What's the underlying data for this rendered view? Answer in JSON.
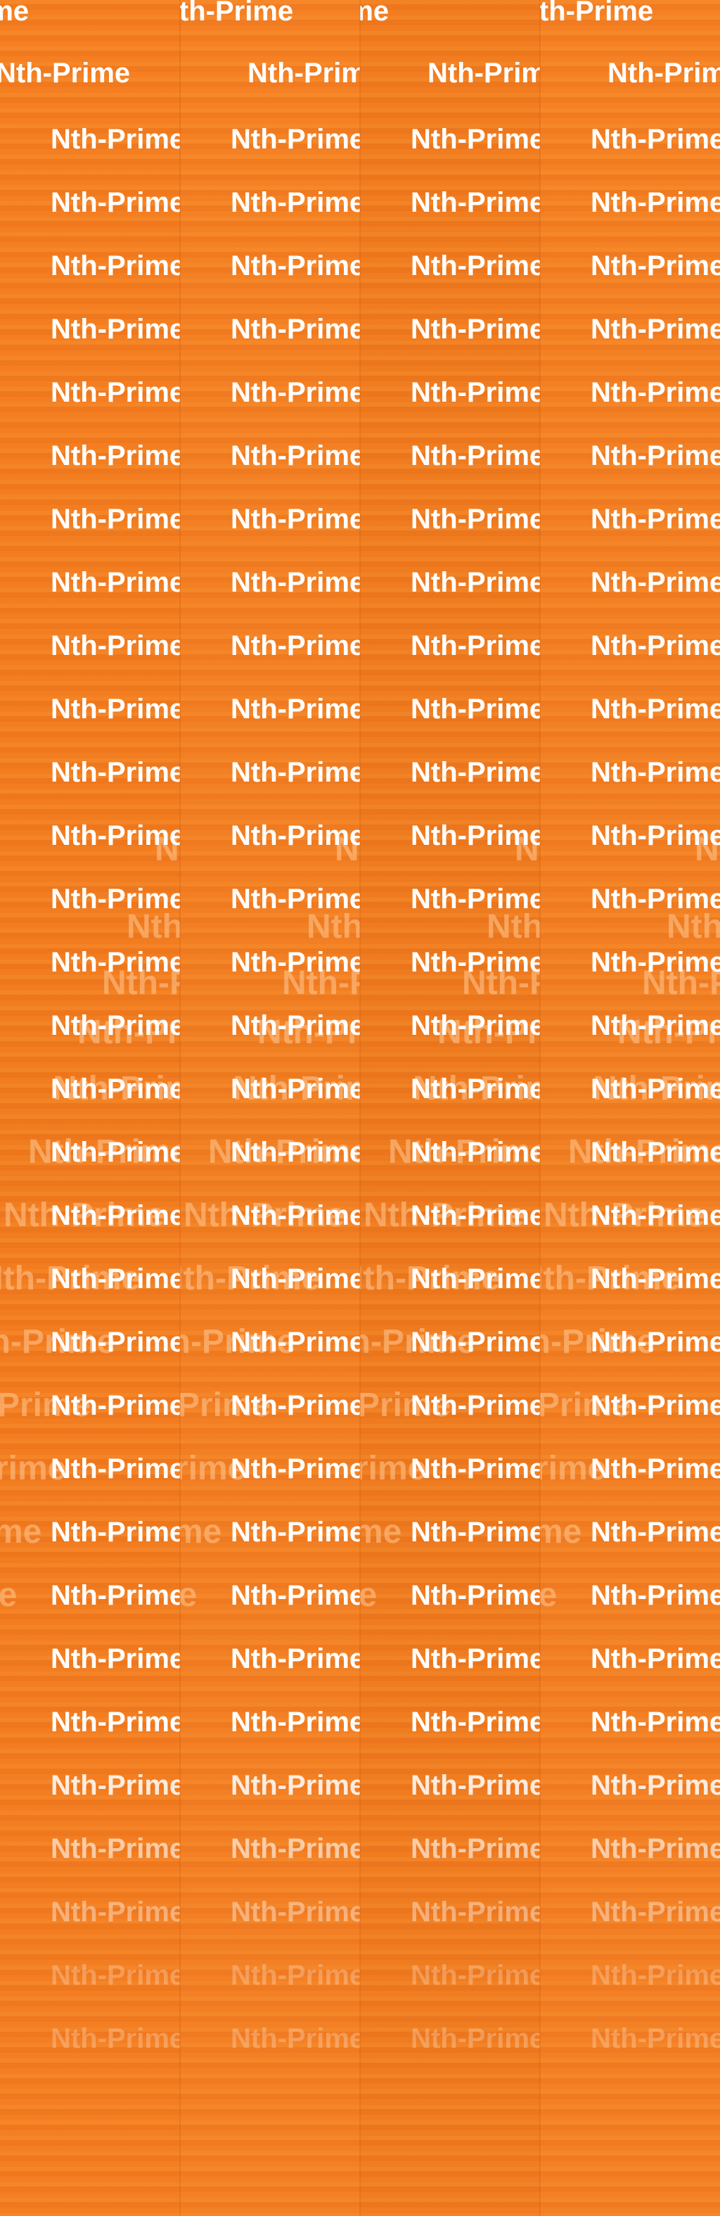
{
  "wallpaper": {
    "text": "Nth-Prime",
    "columns": 4,
    "rows": 33,
    "background_color": "#f07a1c",
    "text_color": "#ffffff"
  }
}
